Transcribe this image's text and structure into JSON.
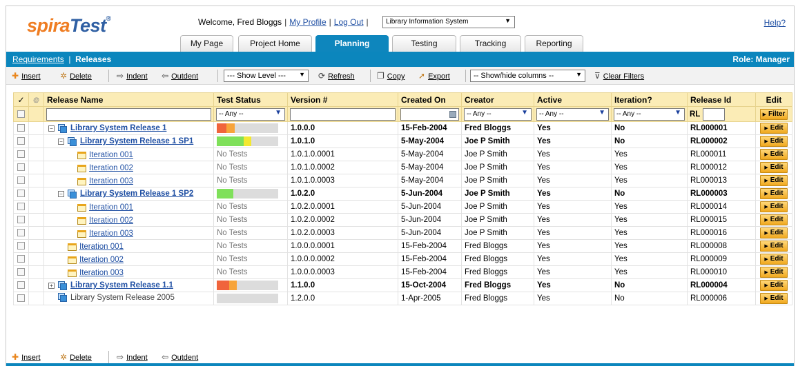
{
  "header": {
    "logo_main": "spira",
    "logo_accent": "Test",
    "logo_tm": "®",
    "welcome_text": "Welcome, Fred Bloggs",
    "my_profile": "My Profile",
    "log_out": "Log Out",
    "project": "Library Information System",
    "help": "Help?"
  },
  "tabs": [
    {
      "label": "My Page"
    },
    {
      "label": "Project Home"
    },
    {
      "label": "Planning"
    },
    {
      "label": "Testing"
    },
    {
      "label": "Tracking"
    },
    {
      "label": "Reporting"
    }
  ],
  "breadcrumb": {
    "parent": "Requirements",
    "separator": "|",
    "current": "Releases"
  },
  "role": "Role: Manager",
  "toolbar": {
    "insert": "Insert",
    "delete": "Delete",
    "indent": "Indent",
    "outdent": "Outdent",
    "show_level": "--- Show Level ---",
    "refresh": "Refresh",
    "copy": "Copy",
    "export": "Export",
    "show_hide": "-- Show/hide columns --",
    "clear_filters": "Clear Filters"
  },
  "columns": {
    "check": "✓",
    "name": "Release Name",
    "test_status": "Test Status",
    "version": "Version #",
    "created_on": "Created On",
    "creator": "Creator",
    "active": "Active",
    "iteration": "Iteration?",
    "release_id": "Release Id",
    "edit": "Edit"
  },
  "filters": {
    "any": "-- Any --",
    "rl_prefix": "RL",
    "filter_button": "Filter"
  },
  "edit_label": "Edit",
  "rows": [
    {
      "name": "Library System Release 1",
      "status": "bar",
      "version": "1.0.0.0",
      "created": "15-Feb-2004",
      "creator": "Fred Bloggs",
      "active": "Yes",
      "iteration": "No",
      "id": "RL000001"
    },
    {
      "name": "Library System Release 1 SP1",
      "status": "bar",
      "version": "1.0.1.0",
      "created": "5-May-2004",
      "creator": "Joe P Smith",
      "active": "Yes",
      "iteration": "No",
      "id": "RL000002"
    },
    {
      "name": "Iteration 001",
      "status": "No Tests",
      "version": "1.0.1.0.0001",
      "created": "5-May-2004",
      "creator": "Joe P Smith",
      "active": "Yes",
      "iteration": "Yes",
      "id": "RL000011"
    },
    {
      "name": "Iteration 002",
      "status": "No Tests",
      "version": "1.0.1.0.0002",
      "created": "5-May-2004",
      "creator": "Joe P Smith",
      "active": "Yes",
      "iteration": "Yes",
      "id": "RL000012"
    },
    {
      "name": "Iteration 003",
      "status": "No Tests",
      "version": "1.0.1.0.0003",
      "created": "5-May-2004",
      "creator": "Joe P Smith",
      "active": "Yes",
      "iteration": "Yes",
      "id": "RL000013"
    },
    {
      "name": "Library System Release 1 SP2",
      "status": "bar",
      "version": "1.0.2.0",
      "created": "5-Jun-2004",
      "creator": "Joe P Smith",
      "active": "Yes",
      "iteration": "No",
      "id": "RL000003"
    },
    {
      "name": "Iteration 001",
      "status": "No Tests",
      "version": "1.0.2.0.0001",
      "created": "5-Jun-2004",
      "creator": "Joe P Smith",
      "active": "Yes",
      "iteration": "Yes",
      "id": "RL000014"
    },
    {
      "name": "Iteration 002",
      "status": "No Tests",
      "version": "1.0.2.0.0002",
      "created": "5-Jun-2004",
      "creator": "Joe P Smith",
      "active": "Yes",
      "iteration": "Yes",
      "id": "RL000015"
    },
    {
      "name": "Iteration 003",
      "status": "No Tests",
      "version": "1.0.2.0.0003",
      "created": "5-Jun-2004",
      "creator": "Joe P Smith",
      "active": "Yes",
      "iteration": "Yes",
      "id": "RL000016"
    },
    {
      "name": "Iteration 001",
      "status": "No Tests",
      "version": "1.0.0.0.0001",
      "created": "15-Feb-2004",
      "creator": "Fred Bloggs",
      "active": "Yes",
      "iteration": "Yes",
      "id": "RL000008"
    },
    {
      "name": "Iteration 002",
      "status": "No Tests",
      "version": "1.0.0.0.0002",
      "created": "15-Feb-2004",
      "creator": "Fred Bloggs",
      "active": "Yes",
      "iteration": "Yes",
      "id": "RL000009"
    },
    {
      "name": "Iteration 003",
      "status": "No Tests",
      "version": "1.0.0.0.0003",
      "created": "15-Feb-2004",
      "creator": "Fred Bloggs",
      "active": "Yes",
      "iteration": "Yes",
      "id": "RL000010"
    },
    {
      "name": "Library System Release 1.1",
      "status": "bar",
      "version": "1.1.0.0",
      "created": "15-Oct-2004",
      "creator": "Fred Bloggs",
      "active": "Yes",
      "iteration": "No",
      "id": "RL000004"
    },
    {
      "name": "Library System Release 2005",
      "status": "bar",
      "version": "1.2.0.0",
      "created": "1-Apr-2005",
      "creator": "Fred Bloggs",
      "active": "Yes",
      "iteration": "No",
      "id": "RL000006"
    }
  ],
  "test_status_fractions": [
    {
      "red": 0.16,
      "orange": 0.13,
      "green": 0,
      "yellow": 0
    },
    {
      "red": 0,
      "orange": 0,
      "green": 0.44,
      "yellow": 0.12
    },
    {},
    {},
    {},
    {
      "red": 0,
      "orange": 0,
      "green": 0.27,
      "yellow": 0
    },
    {},
    {},
    {},
    {},
    {},
    {},
    {
      "red": 0.2,
      "orange": 0.13,
      "green": 0,
      "yellow": 0
    },
    {
      "red": 0,
      "orange": 0,
      "green": 0,
      "yellow": 0
    }
  ],
  "colors": {
    "brand_blue": "#0b86bd",
    "grid_header": "#fbecb6",
    "status_red": "#f0643c",
    "status_orange": "#f7a43a",
    "status_green": "#7fe05a",
    "status_yellow": "#f3e830",
    "link": "#1f4fa3"
  }
}
